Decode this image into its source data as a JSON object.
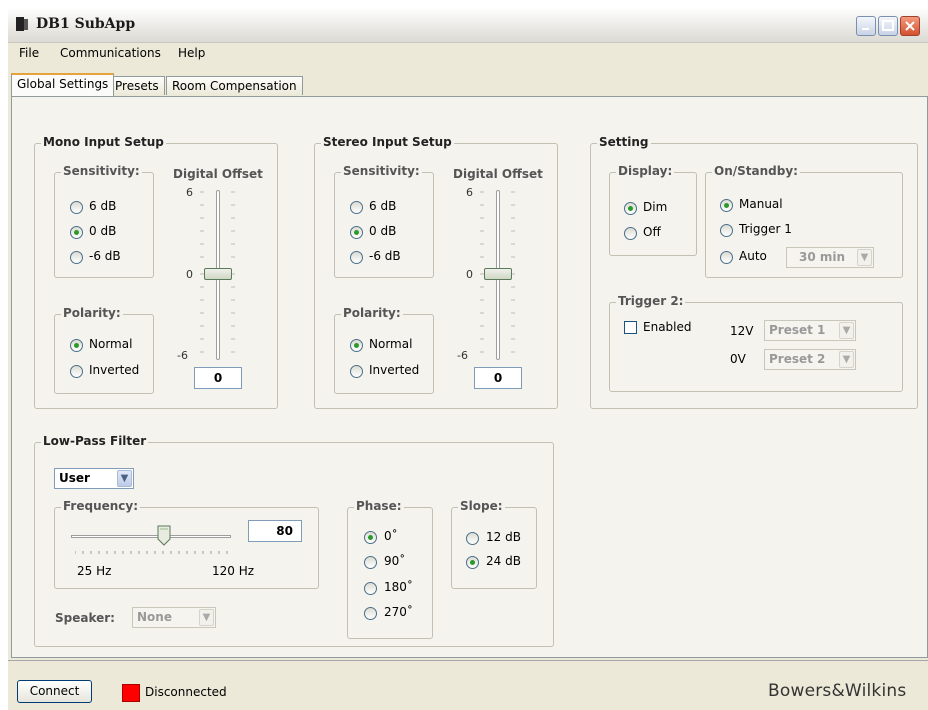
{
  "window": {
    "title": "DB1 SubApp"
  },
  "menu": [
    "File",
    "Communications",
    "Help"
  ],
  "tabs": [
    "Global Settings",
    "Presets",
    "Room Compensation"
  ],
  "mono": {
    "title": "Mono Input Setup",
    "sensitivity_label": "Sensitivity:",
    "sensitivity_options": [
      "6 dB",
      "0 dB",
      "-6 dB"
    ],
    "sensitivity_selected": "0 dB",
    "digital_offset_label": "Digital Offset",
    "offset_ticks": [
      "6",
      "0",
      "-6"
    ],
    "offset_value": "0",
    "polarity_label": "Polarity:",
    "polarity_options": [
      "Normal",
      "Inverted"
    ],
    "polarity_selected": "Normal"
  },
  "stereo": {
    "title": "Stereo Input Setup",
    "sensitivity_label": "Sensitivity:",
    "sensitivity_options": [
      "6 dB",
      "0 dB",
      "-6 dB"
    ],
    "sensitivity_selected": "0 dB",
    "digital_offset_label": "Digital Offset",
    "offset_ticks": [
      "6",
      "0",
      "-6"
    ],
    "offset_value": "0",
    "polarity_label": "Polarity:",
    "polarity_options": [
      "Normal",
      "Inverted"
    ],
    "polarity_selected": "Normal"
  },
  "setting": {
    "title": "Setting",
    "display_label": "Display:",
    "display_options": [
      "Dim",
      "Off"
    ],
    "display_selected": "Dim",
    "standby_label": "On/Standby:",
    "standby_options": [
      "Manual",
      "Trigger 1",
      "Auto"
    ],
    "standby_selected": "Manual",
    "auto_time": "30 min",
    "trigger2_label": "Trigger 2:",
    "enabled_label": "Enabled",
    "enabled_checked": false,
    "v12_label": "12V",
    "v12_preset": "Preset 1",
    "v0_label": "0V",
    "v0_preset": "Preset 2"
  },
  "lpf": {
    "title": "Low-Pass Filter",
    "mode": "User",
    "frequency_label": "Frequency:",
    "frequency_value": "80",
    "freq_min_label": "25 Hz",
    "freq_max_label": "120 Hz",
    "freq_fraction": 0.58,
    "speaker_label": "Speaker:",
    "speaker_value": "None",
    "phase_label": "Phase:",
    "phase_options": [
      "0˚",
      "90˚",
      "180˚",
      "270˚"
    ],
    "phase_selected": "0˚",
    "slope_label": "Slope:",
    "slope_options": [
      "12 dB",
      "24 dB"
    ],
    "slope_selected": "24 dB"
  },
  "status": {
    "connect_label": "Connect",
    "connection_state": "Disconnected",
    "state_color": "#ff0000",
    "brand": "Bowers&Wilkins"
  }
}
